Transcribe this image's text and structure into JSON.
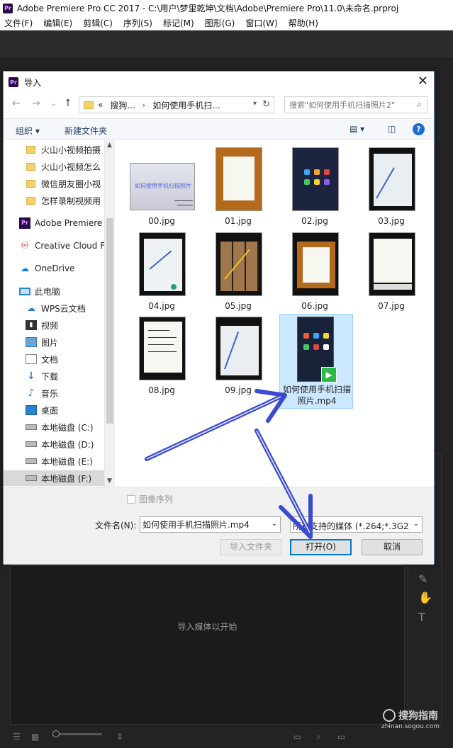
{
  "app": {
    "title": "Adobe Premiere Pro CC 2017 - C:\\用户\\梦里乾坤\\文档\\Adobe\\Premiere Pro\\11.0\\未命名.prproj",
    "logo": "Pr",
    "menu": [
      "文件(F)",
      "编辑(E)",
      "剪辑(C)",
      "序列(S)",
      "标记(M)",
      "图形(G)",
      "窗口(W)",
      "帮助(H)"
    ],
    "lower_panel_text": "导入媒体以开始"
  },
  "dialog": {
    "title": "导入",
    "breadcrumb": [
      "«",
      "搜狗...",
      "如何使用手机扫..."
    ],
    "search_placeholder": "搜索\"如何使用手机扫描照片2\"",
    "toolbar": {
      "organize": "组织 ▾",
      "new_folder": "新建文件夹"
    },
    "nav_items": [
      {
        "icon": "folder-icon",
        "label": "火山小视频拍摄"
      },
      {
        "icon": "folder-icon",
        "label": "火山小视频怎么"
      },
      {
        "icon": "folder-icon",
        "label": "微信朋友圈小视"
      },
      {
        "icon": "folder-icon",
        "label": "怎样录制视频用"
      },
      {
        "icon": "premiere-icon",
        "label": "Adobe Premiere"
      },
      {
        "icon": "creative-cloud-icon",
        "label": "Creative Cloud F"
      },
      {
        "icon": "onedrive-icon",
        "label": "OneDrive"
      },
      {
        "icon": "this-pc-icon",
        "label": "此电脑"
      },
      {
        "icon": "wps-cloud-icon",
        "label": "WPS云文档"
      },
      {
        "icon": "video-icon",
        "label": "视频"
      },
      {
        "icon": "pictures-icon",
        "label": "图片"
      },
      {
        "icon": "documents-icon",
        "label": "文档"
      },
      {
        "icon": "download-icon",
        "label": "下载"
      },
      {
        "icon": "music-icon",
        "label": "音乐"
      },
      {
        "icon": "desktop-icon",
        "label": "桌面"
      },
      {
        "icon": "drive-icon",
        "label": "本地磁盘 (C:)"
      },
      {
        "icon": "drive-icon",
        "label": "本地磁盘 (D:)"
      },
      {
        "icon": "drive-icon",
        "label": "本地磁盘 (E:)"
      },
      {
        "icon": "drive-icon",
        "label": "本地磁盘 (F:)"
      }
    ],
    "selected_nav": "本地磁盘 (F:)",
    "files": [
      {
        "name": "00.jpg",
        "thumb_text": "如何使用手机扫描照片"
      },
      {
        "name": "01.jpg"
      },
      {
        "name": "02.jpg"
      },
      {
        "name": "03.jpg"
      },
      {
        "name": "04.jpg"
      },
      {
        "name": "05.jpg"
      },
      {
        "name": "06.jpg"
      },
      {
        "name": "07.jpg"
      },
      {
        "name": "08.jpg"
      },
      {
        "name": "09.jpg"
      },
      {
        "name": "如何使用手机扫描照片.mp4",
        "selected": true
      }
    ],
    "image_sequence_label": "图像序列",
    "filename_label": "文件名(N):",
    "filename_value": "如何使用手机扫描照片.mp4",
    "filetype_value": "所有支持的媒体 (*.264;*.3G2;*",
    "buttons": {
      "import_folder": "导入文件夹",
      "open": "打开(O)",
      "cancel": "取消"
    }
  },
  "watermark": {
    "title": "搜狗指南",
    "url": "zhinan.sogou.com"
  },
  "colors": {
    "selection": "#cce8ff",
    "primary_border": "#0078d7",
    "annotation_arrow": "#3b4bd1"
  }
}
